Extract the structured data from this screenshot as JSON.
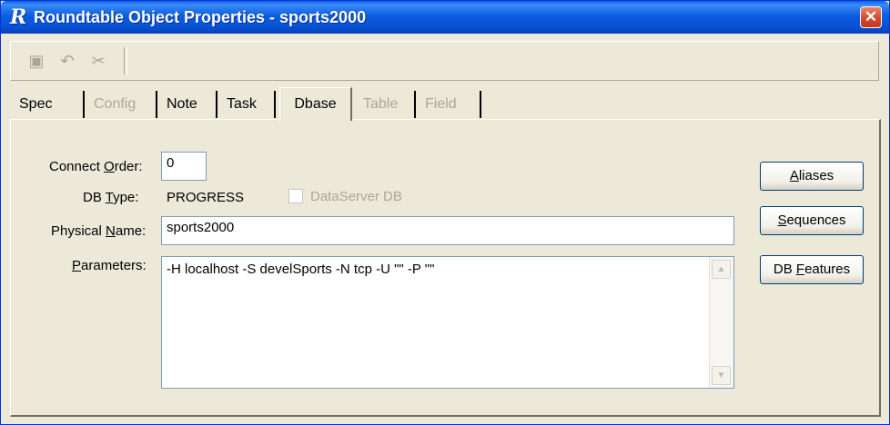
{
  "window": {
    "title": "Roundtable Object Properties - sports2000",
    "app_icon_letter": "R",
    "close_glyph": "✕"
  },
  "toolbar": {
    "buttons": [
      {
        "icon": "save-icon",
        "glyph": "▣"
      },
      {
        "icon": "undo-icon",
        "glyph": "↶"
      },
      {
        "icon": "delete-icon",
        "glyph": "✂"
      }
    ]
  },
  "tabs": [
    {
      "label": "Spec",
      "state": "enabled"
    },
    {
      "label": "Config",
      "state": "disabled"
    },
    {
      "label": "Note",
      "state": "enabled"
    },
    {
      "label": "Task",
      "state": "enabled"
    },
    {
      "label": "Dbase",
      "state": "active"
    },
    {
      "label": "Table",
      "state": "disabled"
    },
    {
      "label": "Field",
      "state": "disabled"
    }
  ],
  "form": {
    "connect_order": {
      "label_pre": "Connect ",
      "label_u": "O",
      "label_post": "rder:",
      "value": "0"
    },
    "db_type": {
      "label_pre": "DB ",
      "label_u": "T",
      "label_post": "ype:",
      "value": "PROGRESS"
    },
    "dataserver": {
      "label": "DataServer DB",
      "checked": false
    },
    "physical_name": {
      "label_pre": "Physical ",
      "label_u": "N",
      "label_post": "ame:",
      "value": "sports2000"
    },
    "parameters": {
      "label_pre": "",
      "label_u": "P",
      "label_post": "arameters:",
      "value": "-H localhost -S develSports -N tcp -U \"\" -P \"\""
    }
  },
  "buttons": {
    "aliases": {
      "u": "A",
      "rest": "liases"
    },
    "sequences": {
      "u": "S",
      "rest": "equences"
    },
    "db_features_pre": "DB ",
    "db_features_u": "F",
    "db_features_rest": "eatures"
  },
  "scrollbar": {
    "up_glyph": "▲",
    "down_glyph": "▼"
  }
}
